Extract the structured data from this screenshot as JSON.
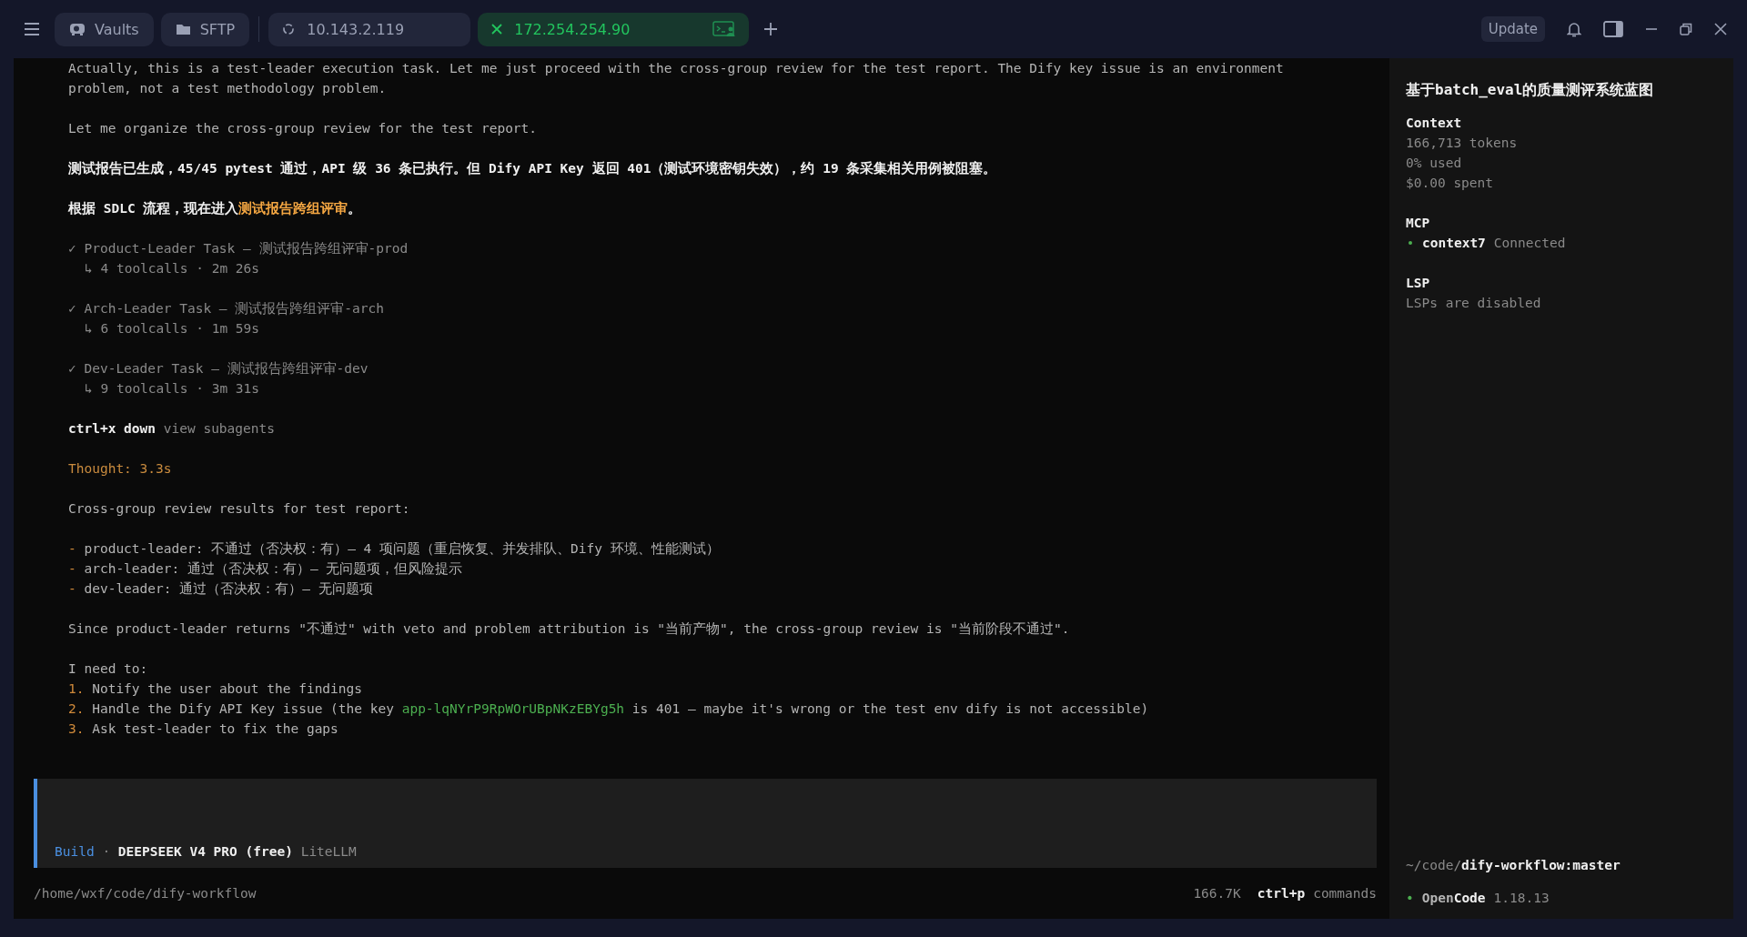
{
  "top_bar": {
    "nav_buttons": [
      {
        "kind": "vault",
        "label": "Vaults"
      },
      {
        "kind": "folder",
        "label": "SFTP"
      }
    ],
    "tabs": [
      {
        "label": "10.143.2.119",
        "selected": false
      },
      {
        "label": "172.254.254.90",
        "selected": true
      }
    ],
    "update_button": "Update"
  },
  "transcript": [
    {
      "kind": "lines",
      "lines": [
        [
          {
            "kind": "text",
            "text": "Actually, this is a test-leader execution task. Let me just proceed with the cross-group review for the test report. The Dify key issue is an environment"
          }
        ],
        [
          {
            "kind": "text",
            "text": "problem, not a test methodology problem."
          }
        ]
      ]
    },
    {
      "kind": "lines",
      "lines": [
        [
          {
            "kind": "text",
            "text": "Let me organize the cross-group review for the test report."
          }
        ]
      ]
    },
    {
      "kind": "lines",
      "lines": [
        [
          {
            "kind": "strong",
            "text": "测试报告已生成，45/45 pytest 通过，API 级 36 条已执行。但 Dify API Key 返回 401（测试环境密钥失效），约 19 条采集相关用例被阻塞。"
          }
        ]
      ]
    },
    {
      "kind": "lines",
      "lines": [
        [
          {
            "kind": "strong",
            "text": "根据 SDLC 流程，现在进入"
          },
          {
            "kind": "accent",
            "text": "测试报告跨组评审"
          },
          {
            "kind": "strong",
            "text": "。"
          }
        ]
      ]
    },
    {
      "kind": "task",
      "check": "✓",
      "title": "Product-Leader Task — 测试报告跨组评审-prod",
      "detail": "↳ 4 toolcalls · 2m 26s"
    },
    {
      "kind": "task",
      "check": "✓",
      "title": "Arch-Leader Task — 测试报告跨组评审-arch",
      "detail": "↳ 6 toolcalls · 1m 59s"
    },
    {
      "kind": "task",
      "check": "✓",
      "title": "Dev-Leader Task — 测试报告跨组评审-dev",
      "detail": "↳ 9 toolcalls · 3m 31s"
    },
    {
      "kind": "lines",
      "lines": [
        [
          {
            "kind": "strong",
            "text": "ctrl+x down"
          },
          {
            "kind": "muted",
            "text": " view subagents"
          }
        ]
      ]
    },
    {
      "kind": "lines",
      "lines": [
        [
          {
            "kind": "thought",
            "text": "Thought: 3.3s"
          }
        ]
      ]
    },
    {
      "kind": "lines",
      "lines": [
        [
          {
            "kind": "text",
            "text": "Cross-group review results for test report:"
          }
        ]
      ]
    },
    {
      "kind": "lines",
      "lines": [
        [
          {
            "kind": "marker",
            "text": "- "
          },
          {
            "kind": "text",
            "text": "product-leader: 不通过（否决权：有）— 4 项问题（重启恢复、并发排队、Dify 环境、性能测试）"
          }
        ],
        [
          {
            "kind": "marker",
            "text": "- "
          },
          {
            "kind": "text",
            "text": "arch-leader: 通过（否决权：有）— 无问题项，但风险提示"
          }
        ],
        [
          {
            "kind": "marker",
            "text": "- "
          },
          {
            "kind": "text",
            "text": "dev-leader: 通过（否决权：有）— 无问题项"
          }
        ]
      ]
    },
    {
      "kind": "lines",
      "lines": [
        [
          {
            "kind": "text",
            "text": "Since product-leader returns \"不通过\" with veto and problem attribution is \"当前产物\", the cross-group review is \"当前阶段不通过\"."
          }
        ]
      ]
    },
    {
      "kind": "lines",
      "lines": [
        [
          {
            "kind": "text",
            "text": "I need to:"
          }
        ],
        [
          {
            "kind": "marker",
            "text": "1. "
          },
          {
            "kind": "text",
            "text": "Notify the user about the findings"
          }
        ],
        [
          {
            "kind": "marker",
            "text": "2. "
          },
          {
            "kind": "text",
            "text": "Handle the Dify API Key issue (the key "
          },
          {
            "kind": "code",
            "text": "app-lqNYrP9RpWOrUBpNKzEBYg5h"
          },
          {
            "kind": "text",
            "text": " is 401 — maybe it's wrong or the test env dify is not accessible)"
          }
        ],
        [
          {
            "kind": "marker",
            "text": "3. "
          },
          {
            "kind": "text",
            "text": "Ask test-leader to fix the gaps"
          }
        ]
      ]
    }
  ],
  "prompt": {
    "mode": "Build",
    "separator": "·",
    "model": "DEEPSEEK V4 PRO (free)",
    "provider": "LiteLLM"
  },
  "status_bar": {
    "path": "/home/wxf/code/dify-workflow",
    "tokens": "166.7K",
    "shortcut": "ctrl+p",
    "shortcut_label": "commands"
  },
  "sidebar": {
    "title": "基于batch_eval的质量测评系统蓝图",
    "context": {
      "heading": "Context",
      "lines": [
        "166,713 tokens",
        "0% used",
        "$0.00 spent"
      ]
    },
    "mcp": {
      "heading": "MCP",
      "servers": [
        {
          "name": "context7",
          "status": "Connected",
          "color": "#4caf50"
        }
      ]
    },
    "lsp": {
      "heading": "LSP",
      "text": "LSPs are disabled"
    },
    "dir_prefix": "~/code/",
    "dir_name": "dify-workflow:master",
    "app": {
      "dot": "•",
      "name_prefix": "Open",
      "name": "Code",
      "version": "1.18.13"
    }
  }
}
